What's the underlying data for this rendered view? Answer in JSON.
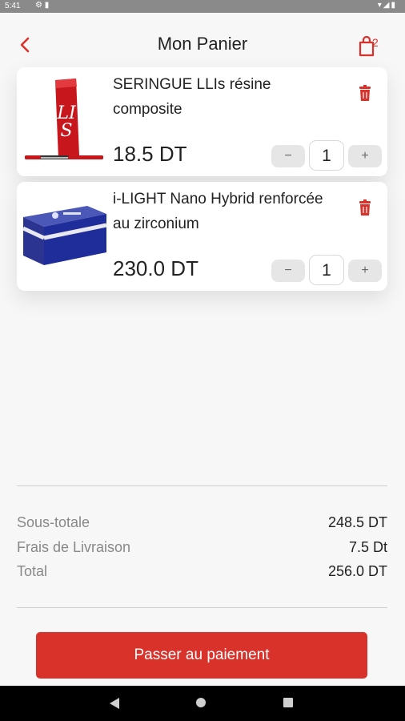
{
  "status_bar": {
    "time": "5:41"
  },
  "header": {
    "title": "Mon Panier",
    "cart_count": "2"
  },
  "items": [
    {
      "name": "SERINGUE LLIs résine composite",
      "price": "18.5 DT",
      "quantity": "1"
    },
    {
      "name": "i-LIGHT  Nano Hybrid renforcée au zirconium",
      "price": "230.0 DT",
      "quantity": "1"
    }
  ],
  "stepper": {
    "minus": "−",
    "plus": "+"
  },
  "summary": {
    "subtotal_label": "Sous-totale",
    "subtotal_value": "248.5 DT",
    "delivery_label": "Frais de Livraison",
    "delivery_value": "7.5 Dt",
    "total_label": "Total",
    "total_value": "256.0 DT"
  },
  "checkout_button": "Passer au paiement",
  "colors": {
    "accent": "#d9322b",
    "background": "#f7f7f7",
    "stepper": "#e6e6e6"
  },
  "icons": [
    "back-chevron-icon",
    "shopping-bag-icon",
    "trash-icon",
    "android-back-icon",
    "android-home-icon",
    "android-recents-icon"
  ]
}
